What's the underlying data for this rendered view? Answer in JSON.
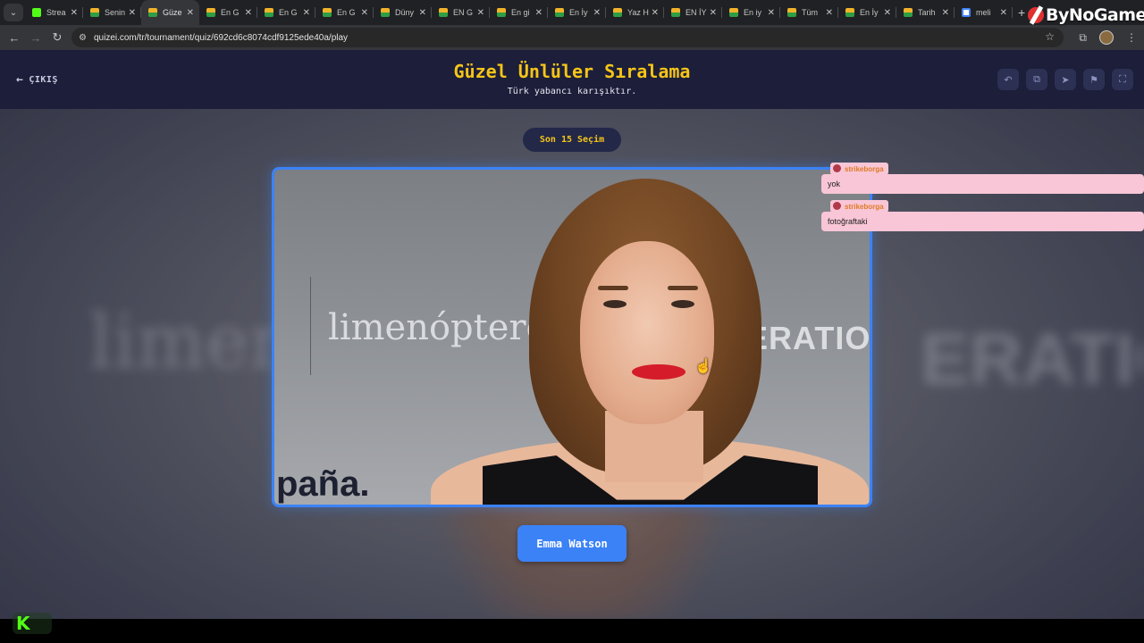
{
  "browser": {
    "tabs": [
      {
        "label": "Strea",
        "fav": "kick",
        "active": false
      },
      {
        "label": "Senin",
        "fav": "quizei",
        "active": false
      },
      {
        "label": "Güze",
        "fav": "quizei",
        "active": true
      },
      {
        "label": "En G",
        "fav": "quizei",
        "active": false
      },
      {
        "label": "En G",
        "fav": "quizei",
        "active": false
      },
      {
        "label": "En G",
        "fav": "quizei",
        "active": false
      },
      {
        "label": "Düny",
        "fav": "quizei",
        "active": false
      },
      {
        "label": "EN G",
        "fav": "quizei",
        "active": false
      },
      {
        "label": "En gi",
        "fav": "quizei",
        "active": false
      },
      {
        "label": "En İy",
        "fav": "quizei",
        "active": false
      },
      {
        "label": "Yaz H",
        "fav": "quizei",
        "active": false
      },
      {
        "label": "EN İY",
        "fav": "quizei",
        "active": false
      },
      {
        "label": "En iy",
        "fav": "quizei",
        "active": false
      },
      {
        "label": "Tüm",
        "fav": "quizei",
        "active": false
      },
      {
        "label": "En İy",
        "fav": "quizei",
        "active": false
      },
      {
        "label": "Tarih",
        "fav": "quizei",
        "active": false
      },
      {
        "label": "meli",
        "fav": "google",
        "active": false
      }
    ],
    "new_tab": "+",
    "url": "quizei.com/tr/tournament/quiz/692cd6c8074cdf9125ede40a/play",
    "watermark": "ByNoGame"
  },
  "header": {
    "exit_label": "ÇIKIŞ",
    "title": "Güzel Ünlüler Sıralama",
    "subtitle": "Türk yabancı karışıktır.",
    "tools": [
      "undo-icon",
      "share-icon",
      "send-icon",
      "flag-icon",
      "fullscreen-icon"
    ]
  },
  "quiz": {
    "history_pill": "Son 15 Seçim",
    "answer_label": "Emma Watson",
    "photo_bg_text": {
      "left": "limenóptero",
      "right": "ERATIO",
      "bottom": "paña."
    },
    "accent_color": "#3b82f6"
  },
  "chat": [
    {
      "user": "strikeborga",
      "message": "yok"
    },
    {
      "user": "strikeborga",
      "message": "fotoğraftaki"
    }
  ],
  "background": {
    "text_left": "limen",
    "text_right": "ERATIO"
  }
}
